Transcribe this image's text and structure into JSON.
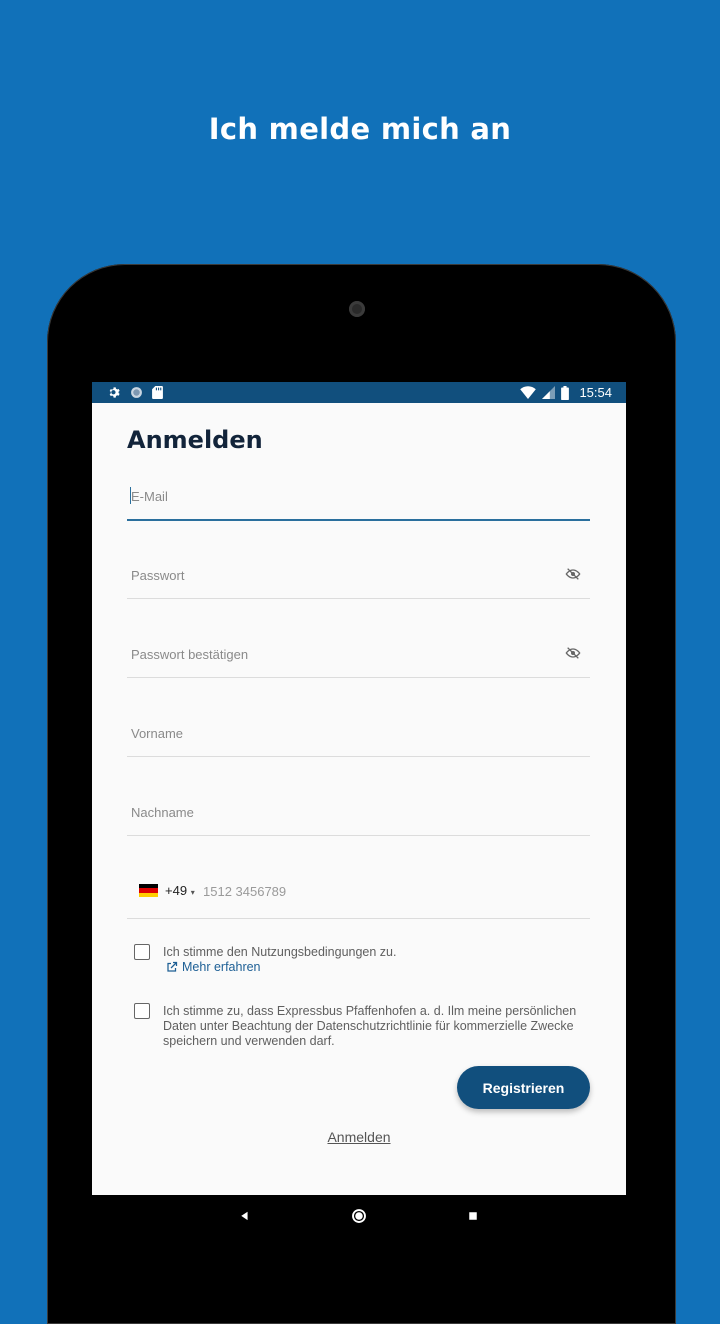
{
  "headline": "Ich melde mich an",
  "status": {
    "time": "15:54"
  },
  "form": {
    "title": "Anmelden",
    "email_placeholder": "E-Mail",
    "password_placeholder": "Passwort",
    "password_confirm_placeholder": "Passwort bestätigen",
    "firstname_placeholder": "Vorname",
    "lastname_placeholder": "Nachname",
    "phone": {
      "country_code": "+49",
      "country": "Germany",
      "placeholder": "1512 3456789"
    },
    "terms_text": "Ich stimme den Nutzungsbedingungen zu.",
    "terms_more": "Mehr erfahren",
    "privacy_text": "Ich stimme zu, dass Expressbus Pfaffenhofen a. d. Ilm meine persönlichen Daten unter Beachtung der Datenschutzrichtlinie für kommerzielle Zwecke speichern und verwenden darf.",
    "register_label": "Registrieren",
    "login_link": "Anmelden"
  },
  "colors": {
    "background": "#1171b9",
    "primary": "#114f7d",
    "accent": "#1d5f95"
  }
}
